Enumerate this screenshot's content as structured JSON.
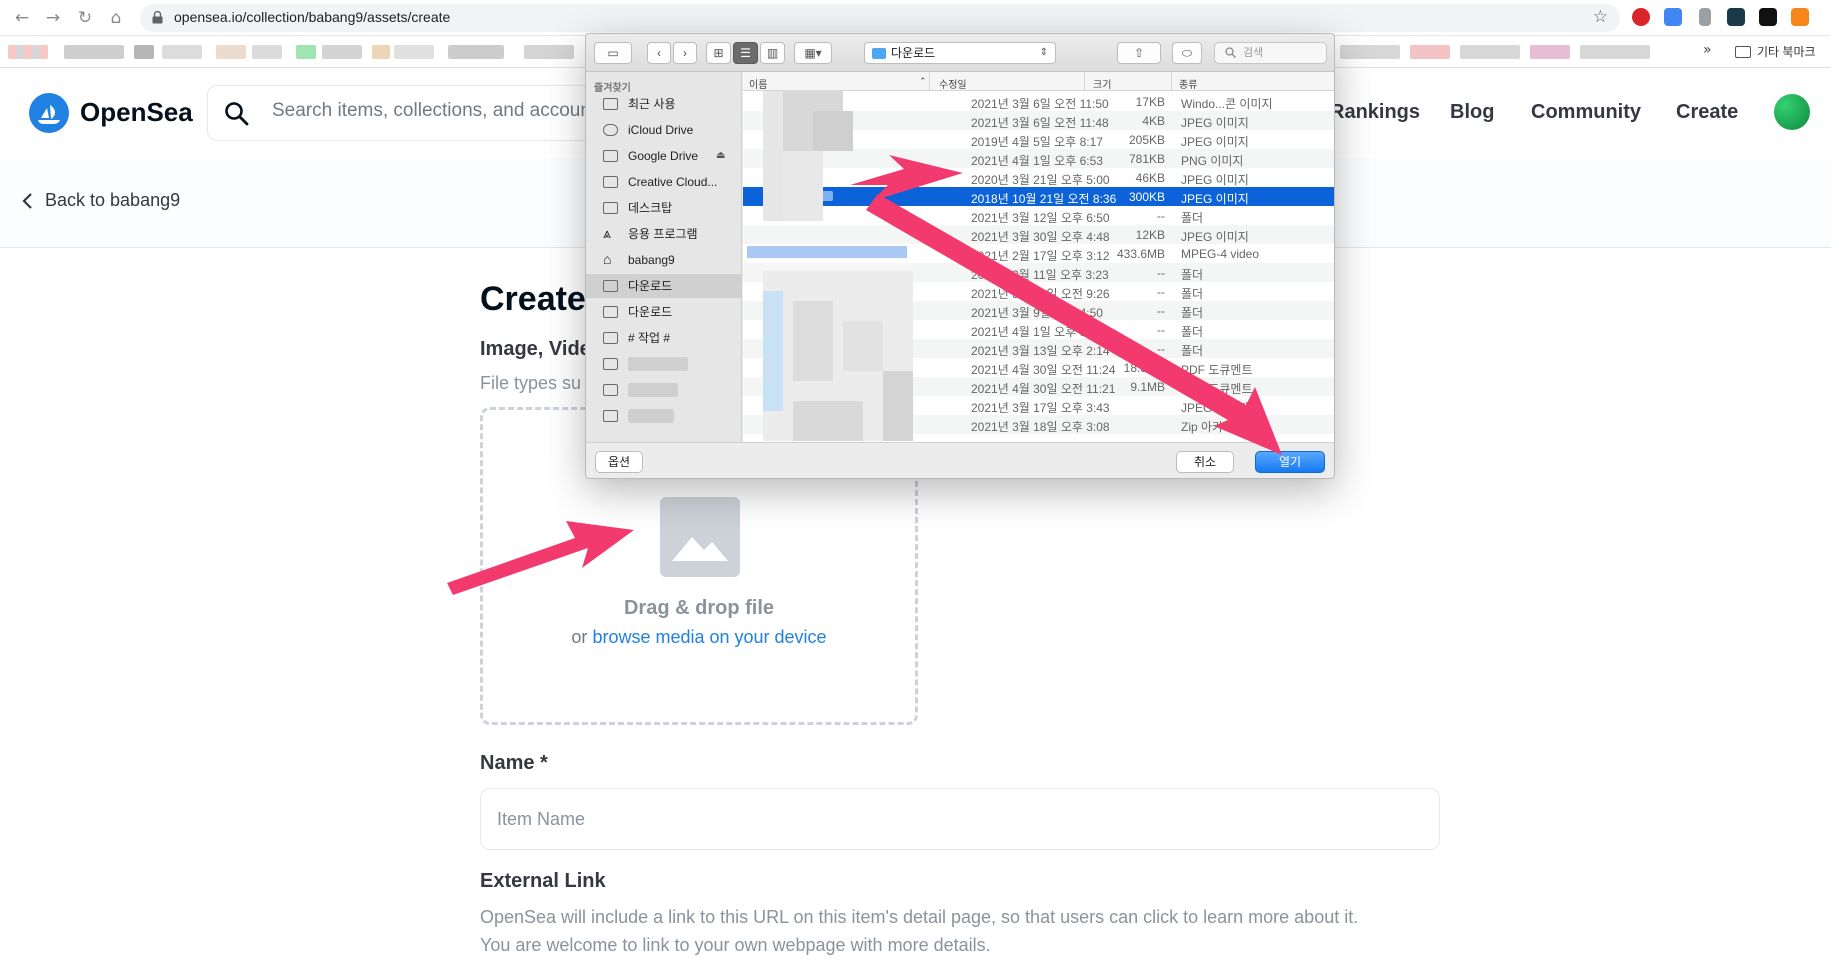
{
  "browser": {
    "url": "opensea.io/collection/babang9/assets/create",
    "bookmarks_folder": "기타 북마크",
    "more": "»"
  },
  "header": {
    "brand": "OpenSea",
    "search_placeholder": "Search items, collections, and accounts",
    "nav": [
      "Rankings",
      "Blog",
      "Community",
      "Create"
    ]
  },
  "subheader": {
    "back_label": "Back to babang9"
  },
  "form": {
    "title": "Create",
    "media_label": "Image, Video",
    "media_hint": "File types su",
    "drop_title": "Drag & drop file",
    "drop_or": "or ",
    "drop_link": "browse media on your device",
    "name_label": "Name *",
    "name_placeholder": "Item Name",
    "external_label": "External Link",
    "external_hint_1": "OpenSea will include a link to this URL on this item's detail page, so that users can click to learn more about it.",
    "external_hint_2": "You are welcome to link to your own webpage with more details."
  },
  "dialog": {
    "location": "다운로드",
    "search_placeholder": "검색",
    "sidebar_header": "즐겨찾기",
    "sidebar": [
      "최근 사용",
      "iCloud Drive",
      "Google Drive",
      "Creative Cloud...",
      "데스크탑",
      "응용 프로그램",
      "babang9",
      "다운로드",
      "다운로드",
      "# 작업 #"
    ],
    "columns": {
      "name": "이름",
      "date": "수정일",
      "size": "크기",
      "kind": "종류"
    },
    "rows": [
      {
        "date": "2021년 3월 6일 오전 11:50",
        "size": "17KB",
        "kind": "Windo...콘 이미지"
      },
      {
        "date": "2021년 3월 6일 오전 11:48",
        "size": "4KB",
        "kind": "JPEG 이미지"
      },
      {
        "date": "2019년 4월 5일 오후 8:17",
        "size": "205KB",
        "kind": "JPEG 이미지"
      },
      {
        "date": "2021년 4월 1일 오후 6:53",
        "size": "781KB",
        "kind": "PNG 이미지"
      },
      {
        "date": "2020년 3월 21일 오후 5:00",
        "size": "46KB",
        "kind": "JPEG 이미지"
      },
      {
        "date": "2018년 10월 21일 오전 8:36",
        "size": "300KB",
        "kind": "JPEG 이미지"
      },
      {
        "date": "2021년 3월 12일 오후 6:50",
        "size": "--",
        "kind": "폴더"
      },
      {
        "date": "2021년 3월 30일 오후 4:48",
        "size": "12KB",
        "kind": "JPEG 이미지"
      },
      {
        "date": "2021년 2월 17일 오후 3:12",
        "size": "433.6MB",
        "kind": "MPEG-4 video"
      },
      {
        "date": "2021년 3월 11일 오후 3:23",
        "size": "--",
        "kind": "폴더"
      },
      {
        "date": "2021년 3월 21일 오전 9:26",
        "size": "--",
        "kind": "폴더"
      },
      {
        "date": "2021년 3월 9일 오전 4:50",
        "size": "--",
        "kind": "폴더"
      },
      {
        "date": "2021년 4월 1일 오후 9:28",
        "size": "--",
        "kind": "폴더"
      },
      {
        "date": "2021년 3월 13일 오후 2:14",
        "size": "--",
        "kind": "폴더"
      },
      {
        "date": "2021년 4월 30일 오전 11:24",
        "size": "18.3MB",
        "kind": "PDF 도큐멘트"
      },
      {
        "date": "2021년 4월 30일 오전 11:21",
        "size": "9.1MB",
        "kind": "PDF 도큐멘트"
      },
      {
        "date": "2021년 3월 17일 오후 3:43",
        "size": "",
        "kind": "JPEG 이미지"
      },
      {
        "date": "2021년 3월 18일 오후 3:08",
        "size": "",
        "kind": "Zip 아카이브"
      }
    ],
    "selected_index": 5,
    "options_label": "옵션",
    "cancel_label": "취소",
    "open_label": "열기"
  },
  "colors": {
    "accent": "#2081e2",
    "annotation": "#f23a6e",
    "selection": "#0c62d9"
  }
}
